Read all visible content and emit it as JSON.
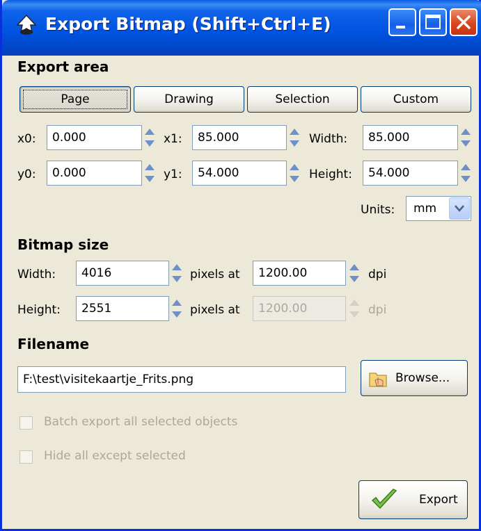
{
  "window": {
    "title": "Export Bitmap (Shift+Ctrl+E)"
  },
  "export_area": {
    "heading": "Export area",
    "buttons": [
      {
        "label": "Page",
        "pressed": true
      },
      {
        "label": "Drawing",
        "pressed": false
      },
      {
        "label": "Selection",
        "pressed": false
      },
      {
        "label": "Custom",
        "pressed": false
      }
    ],
    "x0": {
      "label": "x0:",
      "value": "0.000"
    },
    "x1": {
      "label": "x1:",
      "value": "85.000"
    },
    "width": {
      "label": "Width:",
      "value": "85.000"
    },
    "y0": {
      "label": "y0:",
      "value": "0.000"
    },
    "y1": {
      "label": "y1:",
      "value": "54.000"
    },
    "height": {
      "label": "Height:",
      "value": "54.000"
    },
    "units": {
      "label": "Units:",
      "value": "mm"
    }
  },
  "bitmap_size": {
    "heading": "Bitmap size",
    "width": {
      "label": "Width:",
      "value": "4016",
      "pixels_at": "pixels at",
      "dpi_value": "1200.00",
      "dpi_label": "dpi"
    },
    "height": {
      "label": "Height:",
      "value": "2551",
      "pixels_at": "pixels at",
      "dpi_value": "1200.00",
      "dpi_label": "dpi"
    }
  },
  "filename": {
    "heading": "Filename",
    "value": "F:\\test\\visitekaartje_Frits.png",
    "browse_label": "Browse..."
  },
  "options": {
    "batch_export": {
      "label": "Batch export all selected objects",
      "checked": false
    },
    "hide_except": {
      "label": "Hide all except selected",
      "checked": false
    }
  },
  "export_button": {
    "label": "Export"
  },
  "colors": {
    "titlebar": "#0054e3",
    "dialog_bg": "#ece9d8",
    "field_border": "#7f9db9",
    "disabled_text": "#aca899"
  }
}
